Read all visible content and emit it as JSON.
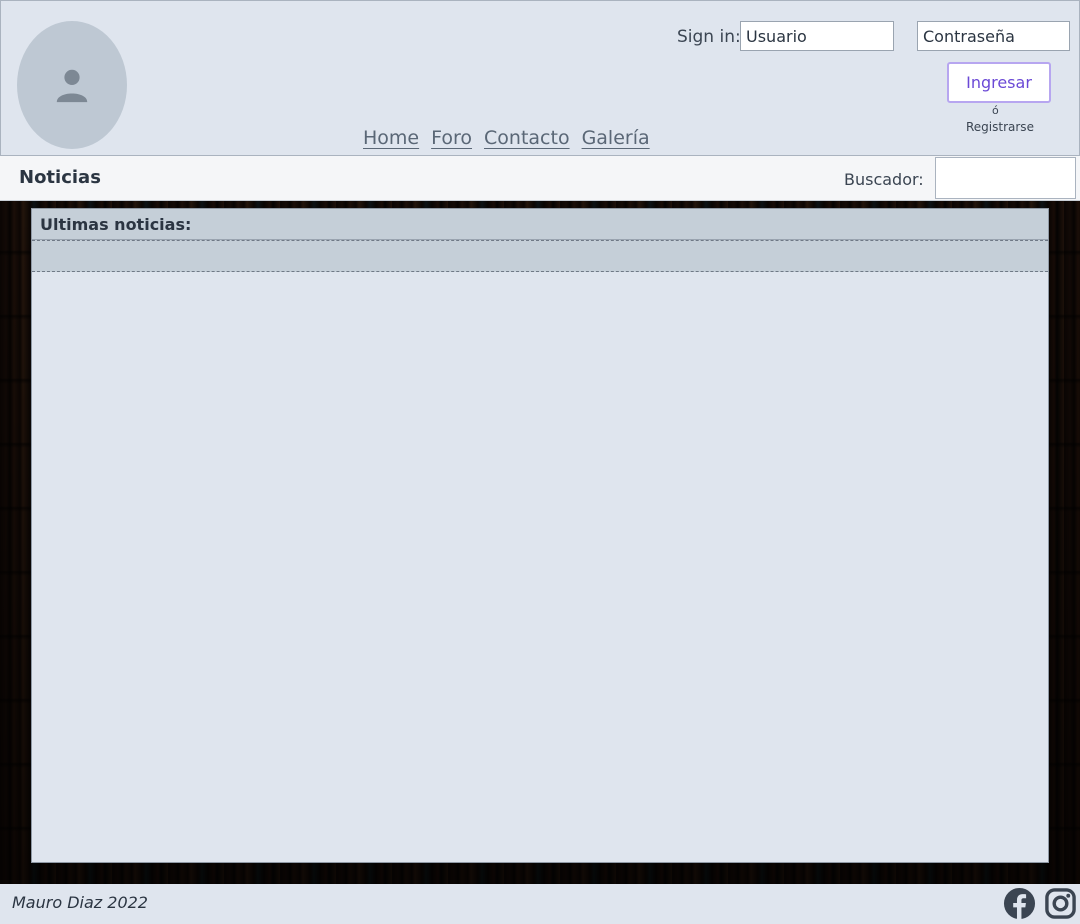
{
  "header": {
    "nav": [
      "Home",
      "Foro",
      "Contacto",
      "Galería"
    ],
    "signin_label": "Sign in:",
    "user_placeholder": "Usuario",
    "pass_placeholder": "Contraseña",
    "login_button": "Ingresar",
    "or_text": "ó",
    "register_link": "Registrarse"
  },
  "subbar": {
    "section_title": "Noticias",
    "search_label": "Buscador:",
    "search_value": ""
  },
  "main": {
    "panel_title": "Ultimas noticias:"
  },
  "footer": {
    "copyright": "Mauro Diaz 2022"
  },
  "icons": {
    "avatar": "user-icon",
    "facebook": "facebook-icon",
    "instagram": "instagram-icon"
  },
  "colors": {
    "header_bg": "#dfe5ee",
    "button_border": "#b7a6f0",
    "button_text": "#6b49d6",
    "panel_header": "#c5cfd8"
  }
}
